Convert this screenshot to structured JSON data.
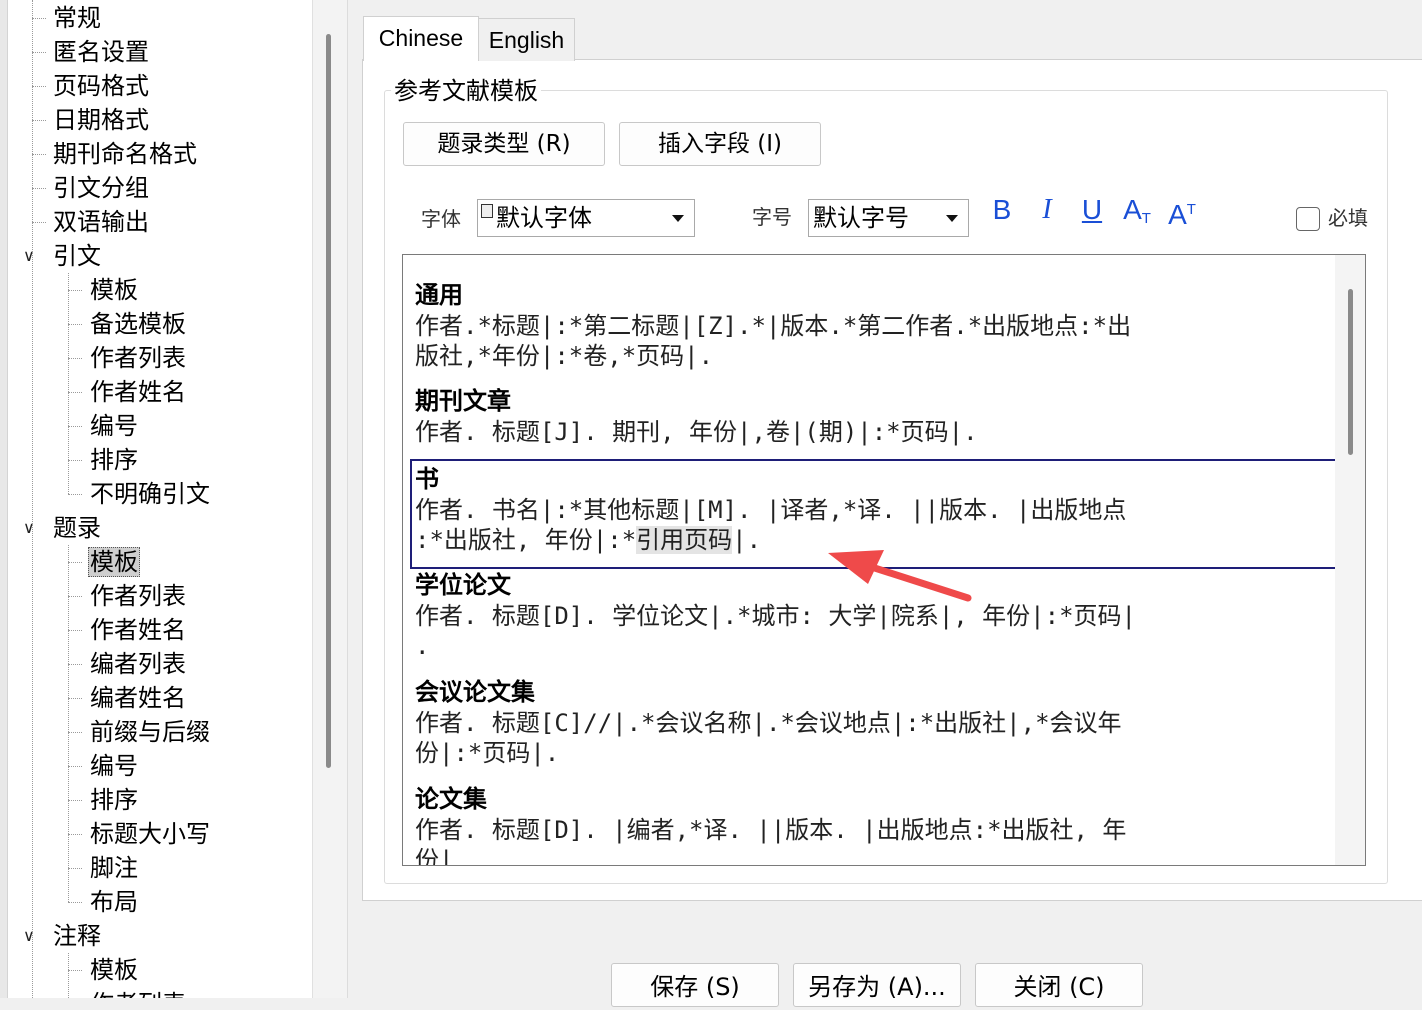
{
  "tree": {
    "items": [
      {
        "label": "常规",
        "level": 1
      },
      {
        "label": "匿名设置",
        "level": 1
      },
      {
        "label": "页码格式",
        "level": 1
      },
      {
        "label": "日期格式",
        "level": 1
      },
      {
        "label": "期刊命名格式",
        "level": 1
      },
      {
        "label": "引文分组",
        "level": 1
      },
      {
        "label": "双语输出",
        "level": 1
      },
      {
        "label": "引文",
        "level": 0,
        "expanded": true
      },
      {
        "label": "模板",
        "level": 2
      },
      {
        "label": "备选模板",
        "level": 2
      },
      {
        "label": "作者列表",
        "level": 2
      },
      {
        "label": "作者姓名",
        "level": 2
      },
      {
        "label": "编号",
        "level": 2
      },
      {
        "label": "排序",
        "level": 2
      },
      {
        "label": "不明确引文",
        "level": 2
      },
      {
        "label": "题录",
        "level": 0,
        "expanded": true
      },
      {
        "label": "模板",
        "level": 2,
        "selected": true
      },
      {
        "label": "作者列表",
        "level": 2
      },
      {
        "label": "作者姓名",
        "level": 2
      },
      {
        "label": "编者列表",
        "level": 2
      },
      {
        "label": "编者姓名",
        "level": 2
      },
      {
        "label": "前缀与后缀",
        "level": 2
      },
      {
        "label": "编号",
        "level": 2
      },
      {
        "label": "排序",
        "level": 2
      },
      {
        "label": "标题大小写",
        "level": 2
      },
      {
        "label": "脚注",
        "level": 2
      },
      {
        "label": "布局",
        "level": 2
      },
      {
        "label": "注释",
        "level": 0,
        "expanded": true
      },
      {
        "label": "模板",
        "level": 2
      },
      {
        "label": "作者列表",
        "level": 2
      }
    ]
  },
  "tabs": [
    {
      "label": "Chinese",
      "active": true
    },
    {
      "label": "English",
      "active": false
    }
  ],
  "group_title": "参考文献模板",
  "toolbar": {
    "entry_type_label": "题录类型 (R)",
    "insert_field_label": "插入字段 (I)",
    "font_label": "字体",
    "font_value": "默认字体",
    "size_label": "字号",
    "size_value": "默认字号",
    "bold": "B",
    "italic": "I",
    "underline": "U",
    "subscript_main": "A",
    "subscript_small": "T",
    "superscript_main": "A",
    "superscript_small": "T",
    "required_label": "必填"
  },
  "templates": [
    {
      "name": "通用",
      "lines": [
        "作者.*标题|:*第二标题|[Z].*|版本.*第二作者.*出版地点:*出",
        "版社,*年份|:*卷,*页码|."
      ]
    },
    {
      "name": "期刊文章",
      "lines": [
        "作者. 标题[J]. 期刊, 年份|,卷|(期)|:*页码|."
      ]
    },
    {
      "name": "书",
      "selected": true,
      "line1": "作者. 书名|:*其他标题|[M]. |译者,*译. ||版本. |出版地点",
      "line2_pre": ":*出版社, 年份|:*",
      "line2_hl": "引用页码",
      "line2_post": "|."
    },
    {
      "name": "学位论文",
      "lines": [
        "作者. 标题[D]. 学位论文|.*城市: 大学|院系|, 年份|:*页码|",
        "."
      ]
    },
    {
      "name": "会议论文集",
      "lines": [
        "作者. 标题[C]//|.*会议名称|.*会议地点|:*出版社|,*会议年",
        "份|:*页码|."
      ]
    },
    {
      "name": "论文集",
      "lines": [
        "作者. 标题[D]. |编者,*译. ||版本. |出版地点:*出版社, 年",
        "份|"
      ]
    }
  ],
  "buttons": {
    "save": "保存 (S)",
    "save_as": "另存为 (A)...",
    "close": "关闭 (C)"
  },
  "colors": {
    "accent": "#1a4fd6",
    "arrow": "#ef4a4a",
    "selection_border": "#1e1e78"
  }
}
